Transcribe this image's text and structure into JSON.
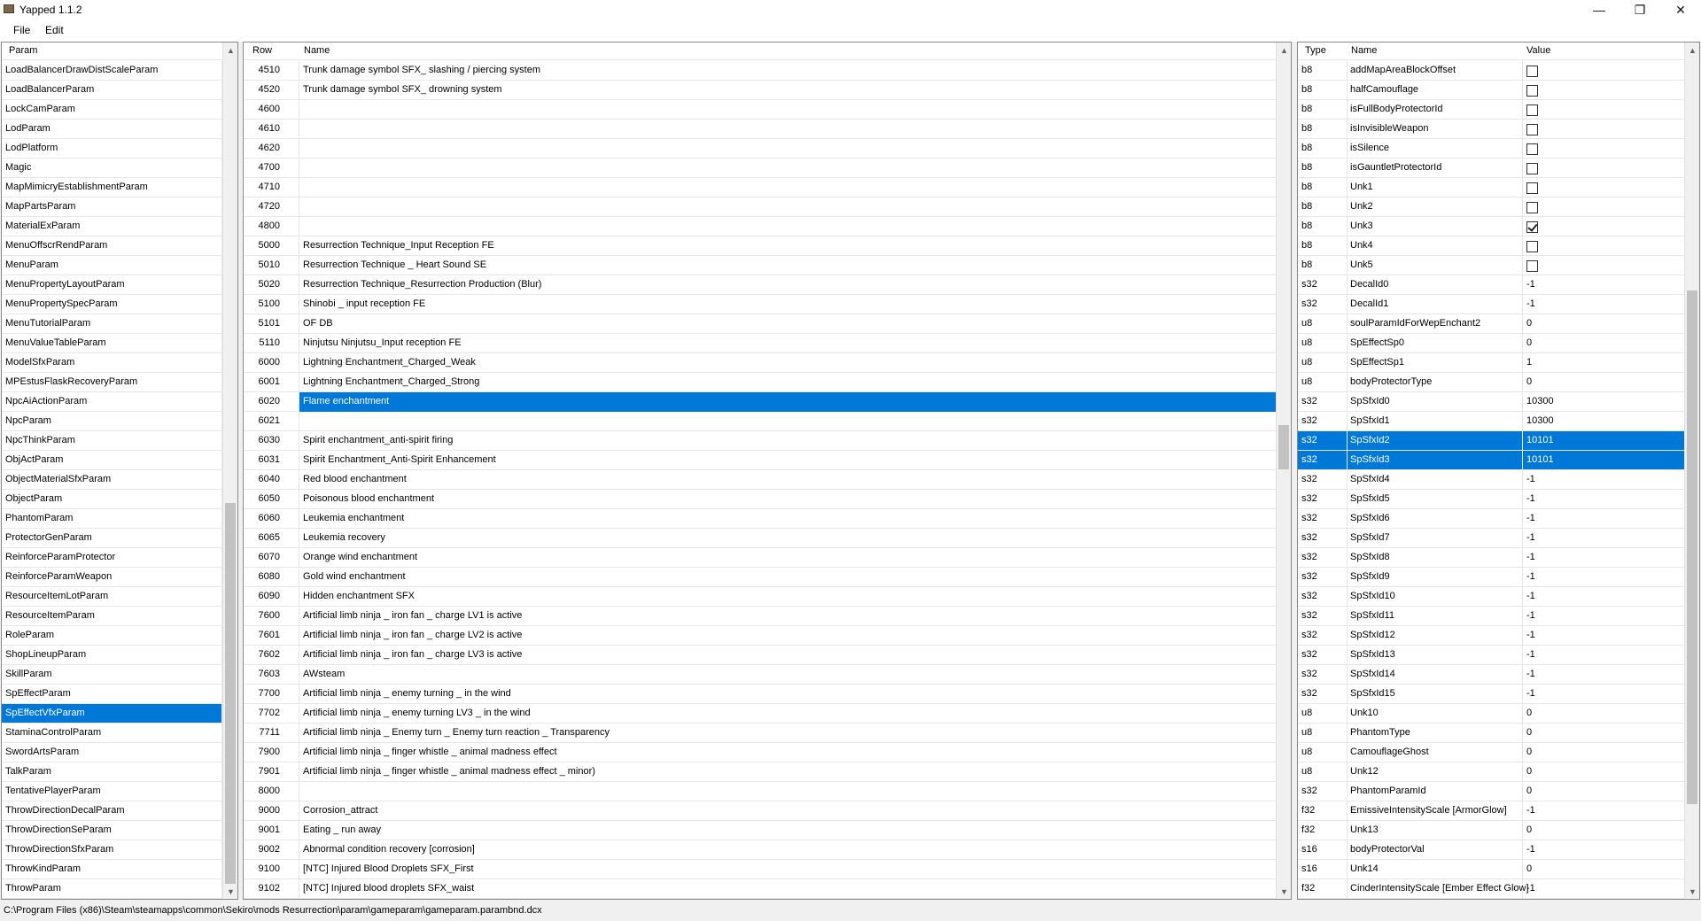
{
  "window": {
    "title": "Yapped 1.1.2",
    "minimize": "—",
    "maximize": "❐",
    "close": "✕"
  },
  "menu": {
    "file": "File",
    "edit": "Edit"
  },
  "params_panel": {
    "header": "Param",
    "items": [
      "LoadBalancerDrawDistScaleParam",
      "LoadBalancerParam",
      "LockCamParam",
      "LodParam",
      "LodPlatform",
      "Magic",
      "MapMimicryEstablishmentParam",
      "MapPartsParam",
      "MaterialExParam",
      "MenuOffscrRendParam",
      "MenuParam",
      "MenuPropertyLayoutParam",
      "MenuPropertySpecParam",
      "MenuTutorialParam",
      "MenuValueTableParam",
      "ModelSfxParam",
      "MPEstusFlaskRecoveryParam",
      "NpcAiActionParam",
      "NpcParam",
      "NpcThinkParam",
      "ObjActParam",
      "ObjectMaterialSfxParam",
      "ObjectParam",
      "PhantomParam",
      "ProtectorGenParam",
      "ReinforceParamProtector",
      "ReinforceParamWeapon",
      "ResourceItemLotParam",
      "ResourceItemParam",
      "RoleParam",
      "ShopLineupParam",
      "SkillParam",
      "SpEffectParam",
      "SpEffectVfxParam",
      "StaminaControlParam",
      "SwordArtsParam",
      "TalkParam",
      "TentativePlayerParam",
      "ThrowDirectionDecalParam",
      "ThrowDirectionSeParam",
      "ThrowDirectionSfxParam",
      "ThrowKindParam",
      "ThrowParam"
    ],
    "selected_index": 33
  },
  "rows_panel": {
    "headers": {
      "row": "Row",
      "name": "Name"
    },
    "rows": [
      {
        "id": "4510",
        "name": "Trunk damage symbol SFX_ slashing / piercing system"
      },
      {
        "id": "4520",
        "name": "Trunk damage symbol SFX_ drowning system"
      },
      {
        "id": "4600",
        "name": ""
      },
      {
        "id": "4610",
        "name": ""
      },
      {
        "id": "4620",
        "name": ""
      },
      {
        "id": "4700",
        "name": ""
      },
      {
        "id": "4710",
        "name": ""
      },
      {
        "id": "4720",
        "name": ""
      },
      {
        "id": "4800",
        "name": ""
      },
      {
        "id": "5000",
        "name": "Resurrection Technique_Input Reception FE"
      },
      {
        "id": "5010",
        "name": "Resurrection Technique _ Heart Sound SE"
      },
      {
        "id": "5020",
        "name": "Resurrection Technique_Resurrection Production (Blur)"
      },
      {
        "id": "5100",
        "name": "Shinobi _ input reception FE"
      },
      {
        "id": "5101",
        "name": "OF DB"
      },
      {
        "id": "5110",
        "name": "Ninjutsu Ninjutsu_Input reception FE"
      },
      {
        "id": "6000",
        "name": "Lightning Enchantment_Charged_Weak"
      },
      {
        "id": "6001",
        "name": "Lightning Enchantment_Charged_Strong"
      },
      {
        "id": "6020",
        "name": "Flame enchantment"
      },
      {
        "id": "6021",
        "name": ""
      },
      {
        "id": "6030",
        "name": "Spirit enchantment_anti-spirit firing"
      },
      {
        "id": "6031",
        "name": "Spirit Enchantment_Anti-Spirit Enhancement"
      },
      {
        "id": "6040",
        "name": "Red blood enchantment"
      },
      {
        "id": "6050",
        "name": "Poisonous blood enchantment"
      },
      {
        "id": "6060",
        "name": "Leukemia enchantment"
      },
      {
        "id": "6065",
        "name": "Leukemia recovery"
      },
      {
        "id": "6070",
        "name": "Orange wind enchantment"
      },
      {
        "id": "6080",
        "name": "Gold wind enchantment"
      },
      {
        "id": "6090",
        "name": "Hidden enchantment SFX"
      },
      {
        "id": "7600",
        "name": "Artificial limb ninja _ iron fan _ charge LV1 is active"
      },
      {
        "id": "7601",
        "name": "Artificial limb ninja _ iron fan _ charge LV2 is active"
      },
      {
        "id": "7602",
        "name": "Artificial limb ninja _ iron fan _ charge LV3 is active"
      },
      {
        "id": "7603",
        "name": "AWsteam"
      },
      {
        "id": "7700",
        "name": "Artificial limb ninja _ enemy turning _ in the wind"
      },
      {
        "id": "7702",
        "name": "Artificial limb ninja _ enemy turning LV3 _ in the wind"
      },
      {
        "id": "7711",
        "name": "Artificial limb ninja _ Enemy turn _ Enemy turn reaction _ Transparency"
      },
      {
        "id": "7900",
        "name": "Artificial limb ninja _ finger whistle _ animal madness effect"
      },
      {
        "id": "7901",
        "name": "Artificial limb ninja _ finger whistle _ animal madness effect _ minor)"
      },
      {
        "id": "8000",
        "name": ""
      },
      {
        "id": "9000",
        "name": "Corrosion_attract"
      },
      {
        "id": "9001",
        "name": "Eating _ run away"
      },
      {
        "id": "9002",
        "name": "Abnormal condition recovery [corrosion]"
      },
      {
        "id": "9100",
        "name": "[NTC] Injured Blood Droplets SFX_First"
      },
      {
        "id": "9102",
        "name": "[NTC] Injured blood droplets SFX_waist"
      }
    ],
    "selected_index": 17
  },
  "fields_panel": {
    "headers": {
      "type": "Type",
      "name": "Name",
      "value": "Value"
    },
    "fields": [
      {
        "type": "b8",
        "name": "addMapAreaBlockOffset",
        "value": "",
        "checkbox": true,
        "checked": false
      },
      {
        "type": "b8",
        "name": "halfCamouflage",
        "value": "",
        "checkbox": true,
        "checked": false
      },
      {
        "type": "b8",
        "name": "isFullBodyProtectorId",
        "value": "",
        "checkbox": true,
        "checked": false
      },
      {
        "type": "b8",
        "name": "isInvisibleWeapon",
        "value": "",
        "checkbox": true,
        "checked": false
      },
      {
        "type": "b8",
        "name": "isSilence",
        "value": "",
        "checkbox": true,
        "checked": false
      },
      {
        "type": "b8",
        "name": "isGauntletProtectorId",
        "value": "",
        "checkbox": true,
        "checked": false
      },
      {
        "type": "b8",
        "name": "Unk1",
        "value": "",
        "checkbox": true,
        "checked": false
      },
      {
        "type": "b8",
        "name": "Unk2",
        "value": "",
        "checkbox": true,
        "checked": false
      },
      {
        "type": "b8",
        "name": "Unk3",
        "value": "",
        "checkbox": true,
        "checked": true
      },
      {
        "type": "b8",
        "name": "Unk4",
        "value": "",
        "checkbox": true,
        "checked": false
      },
      {
        "type": "b8",
        "name": "Unk5",
        "value": "",
        "checkbox": true,
        "checked": false
      },
      {
        "type": "s32",
        "name": "DecalId0",
        "value": "-1"
      },
      {
        "type": "s32",
        "name": "DecalId1",
        "value": "-1"
      },
      {
        "type": "u8",
        "name": "soulParamIdForWepEnchant2",
        "value": "0"
      },
      {
        "type": "u8",
        "name": "SpEffectSp0",
        "value": "0"
      },
      {
        "type": "u8",
        "name": "SpEffectSp1",
        "value": "1"
      },
      {
        "type": "u8",
        "name": "bodyProtectorType",
        "value": "0"
      },
      {
        "type": "s32",
        "name": "SpSfxId0",
        "value": "10300"
      },
      {
        "type": "s32",
        "name": "SpSfxId1",
        "value": "10300"
      },
      {
        "type": "s32",
        "name": "SpSfxId2",
        "value": "10101",
        "selected": true
      },
      {
        "type": "s32",
        "name": "SpSfxId3",
        "value": "10101",
        "selected": true
      },
      {
        "type": "s32",
        "name": "SpSfxId4",
        "value": "-1"
      },
      {
        "type": "s32",
        "name": "SpSfxId5",
        "value": "-1"
      },
      {
        "type": "s32",
        "name": "SpSfxId6",
        "value": "-1"
      },
      {
        "type": "s32",
        "name": "SpSfxId7",
        "value": "-1"
      },
      {
        "type": "s32",
        "name": "SpSfxId8",
        "value": "-1"
      },
      {
        "type": "s32",
        "name": "SpSfxId9",
        "value": "-1"
      },
      {
        "type": "s32",
        "name": "SpSfxId10",
        "value": "-1"
      },
      {
        "type": "s32",
        "name": "SpSfxId11",
        "value": "-1"
      },
      {
        "type": "s32",
        "name": "SpSfxId12",
        "value": "-1"
      },
      {
        "type": "s32",
        "name": "SpSfxId13",
        "value": "-1"
      },
      {
        "type": "s32",
        "name": "SpSfxId14",
        "value": "-1"
      },
      {
        "type": "s32",
        "name": "SpSfxId15",
        "value": "-1"
      },
      {
        "type": "u8",
        "name": "Unk10",
        "value": "0"
      },
      {
        "type": "u8",
        "name": "PhantomType",
        "value": "0"
      },
      {
        "type": "u8",
        "name": "CamouflageGhost",
        "value": "0"
      },
      {
        "type": "u8",
        "name": "Unk12",
        "value": "0"
      },
      {
        "type": "s32",
        "name": "PhantomParamId",
        "value": "0"
      },
      {
        "type": "f32",
        "name": "EmissiveIntensityScale [ArmorGlow]",
        "value": "-1"
      },
      {
        "type": "f32",
        "name": "Unk13",
        "value": "0"
      },
      {
        "type": "s16",
        "name": "bodyProtectorVal",
        "value": "-1"
      },
      {
        "type": "s16",
        "name": "Unk14",
        "value": "0"
      },
      {
        "type": "f32",
        "name": "CinderIntensityScale [Ember Effect Glow]",
        "value": "-1"
      }
    ]
  },
  "scroll_arrows": {
    "up": "▲",
    "down": "▼"
  },
  "status": {
    "path": "C:\\Program Files (x86)\\Steam\\steamapps\\common\\Sekiro\\mods Resurrection\\param\\gameparam\\gameparam.parambnd.dcx"
  },
  "colors": {
    "selection": "#0078d7"
  }
}
